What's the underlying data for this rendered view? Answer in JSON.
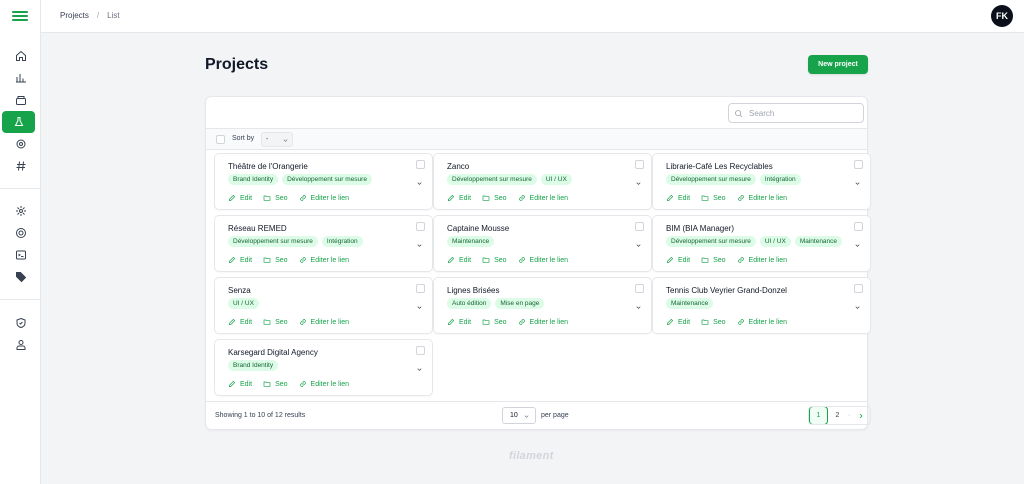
{
  "breadcrumb": {
    "projects": "Projects",
    "separator": "/",
    "current": "List"
  },
  "user": {
    "initials": "FK"
  },
  "page": {
    "title": "Projects",
    "new_button": "New project"
  },
  "search": {
    "placeholder": "Search",
    "value": ""
  },
  "sort": {
    "label": "Sort by",
    "value": "-"
  },
  "actions": {
    "edit": "Edit",
    "seo": "Seo",
    "link": "Editer le lien"
  },
  "cards": [
    {
      "title": "Théâtre de l'Orangerie",
      "tags": [
        "Brand Identity",
        "Développement sur mesure"
      ]
    },
    {
      "title": "Zanco",
      "tags": [
        "Développement sur mesure",
        "UI / UX"
      ]
    },
    {
      "title": "Librarie-Café Les Recyclables",
      "tags": [
        "Développement sur mesure",
        "Intégration"
      ]
    },
    {
      "title": "Réseau REMED",
      "tags": [
        "Développement sur mesure",
        "Intégration"
      ]
    },
    {
      "title": "Captaine Mousse",
      "tags": [
        "Maintenance"
      ]
    },
    {
      "title": "BIM (BIA Manager)",
      "tags": [
        "Développement sur mesure",
        "UI / UX",
        "Maintenance"
      ]
    },
    {
      "title": "Senza",
      "tags": [
        "UI / UX"
      ]
    },
    {
      "title": "Lignes Brisées",
      "tags": [
        "Auto édition",
        "Mise en page"
      ]
    },
    {
      "title": "Tennis Club Veyrier Grand-Donzel",
      "tags": [
        "Maintenance"
      ]
    },
    {
      "title": "Karsegard Digital Agency",
      "tags": [
        "Brand Identity"
      ]
    }
  ],
  "footer": {
    "showing": "Showing 1 to 10 of 12 results",
    "per_page_value": "10",
    "per_page_label": "per page"
  },
  "pagination": {
    "pages": [
      "1",
      "2"
    ],
    "active": "1",
    "separator": "·"
  },
  "brand": {
    "name": "filament"
  },
  "colors": {
    "accent": "#16a34a",
    "tag_bg": "#dcfce7",
    "tag_text": "#166534"
  },
  "sidebar": {
    "menu_icon": "hamburger-icon",
    "group1": [
      "home-icon",
      "chart-icon",
      "box-icon",
      "flask-icon",
      "settings-icon",
      "hash-icon"
    ],
    "active_index": 3,
    "group2": [
      "cog-icon",
      "gear-icon",
      "terminal-icon",
      "tag-icon"
    ],
    "group3": [
      "shield-icon",
      "users-icon"
    ]
  }
}
